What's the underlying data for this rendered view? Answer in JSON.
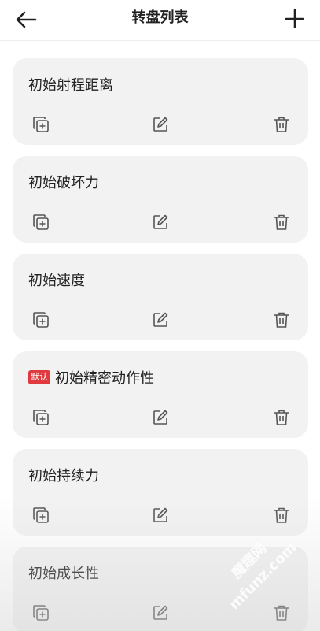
{
  "header": {
    "title": "转盘列表",
    "back_icon": "arrow-left-icon",
    "add_icon": "plus-icon"
  },
  "cards": [
    {
      "name": "初始射程距离",
      "badge": ""
    },
    {
      "name": "初始破坏力",
      "badge": ""
    },
    {
      "name": "初始速度",
      "badge": ""
    },
    {
      "name": "初始精密动作性",
      "badge": "默认"
    },
    {
      "name": "初始持续力",
      "badge": ""
    },
    {
      "name": "初始成长性",
      "badge": ""
    }
  ],
  "actions": {
    "copy_icon": "copy-add-icon",
    "edit_icon": "edit-icon",
    "delete_icon": "trash-icon"
  },
  "watermark": {
    "domain": "mfunz.com",
    "site": "魔趣网"
  },
  "colors": {
    "card_bg": "#f2f2f2",
    "badge_bg": "#e0393e",
    "icon": "#555555"
  }
}
